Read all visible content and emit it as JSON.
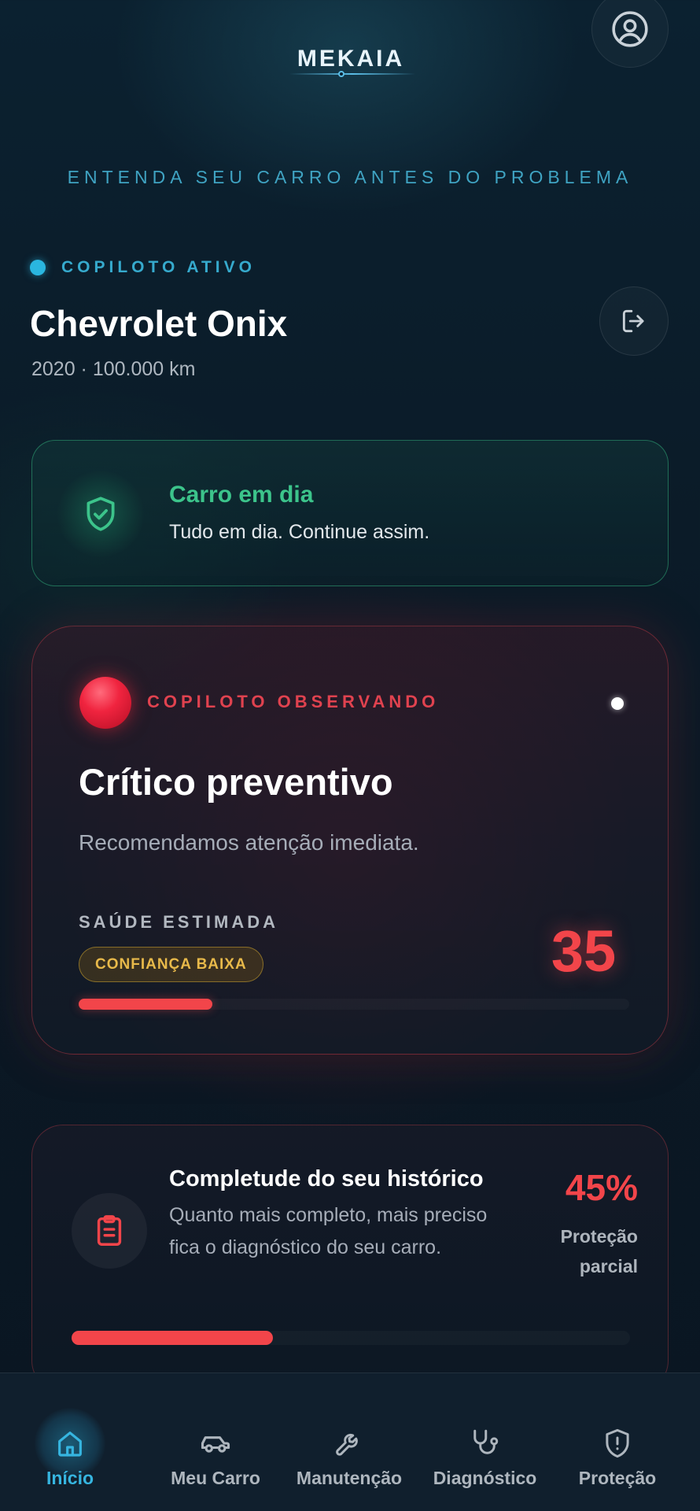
{
  "header": {
    "logo_text": "MEKAIA"
  },
  "tagline": "ENTENDA SEU CARRO ANTES DO PROBLEMA",
  "vehicle": {
    "copilot_status": "COPILOTO ATIVO",
    "name": "Chevrolet Onix",
    "meta": "2020 · 100.000 km"
  },
  "status_card": {
    "title": "Carro em dia",
    "subtitle": "Tudo em dia. Continue assim."
  },
  "critical_card": {
    "status": "COPILOTO OBSERVANDO",
    "title": "Crítico preventivo",
    "subtitle": "Recomendamos atenção imediata.",
    "health_label": "SAÚDE ESTIMADA",
    "confidence": "CONFIANÇA BAIXA",
    "score": "35",
    "health_fraction": 0.35
  },
  "history_card": {
    "title": "Completude do seu histórico",
    "description": "Quanto mais completo, mais preciso fica o diagnóstico do seu carro.",
    "percent": "45%",
    "protection_line1": "Proteção",
    "protection_line2": "parcial",
    "completeness_fraction": 0.45
  },
  "nav": {
    "items": [
      {
        "label": "Início",
        "icon": "home-icon",
        "active": true
      },
      {
        "label": "Meu Carro",
        "icon": "car-icon",
        "active": false
      },
      {
        "label": "Manutenção",
        "icon": "wrench-icon",
        "active": false
      },
      {
        "label": "Diagnóstico",
        "icon": "stethoscope-icon",
        "active": false
      },
      {
        "label": "Proteção",
        "icon": "shield-alert-icon",
        "active": false
      }
    ]
  },
  "colors": {
    "accent": "#36b5e0",
    "success": "#3cc48b",
    "danger": "#f2454a",
    "warning": "#e8b94a"
  }
}
